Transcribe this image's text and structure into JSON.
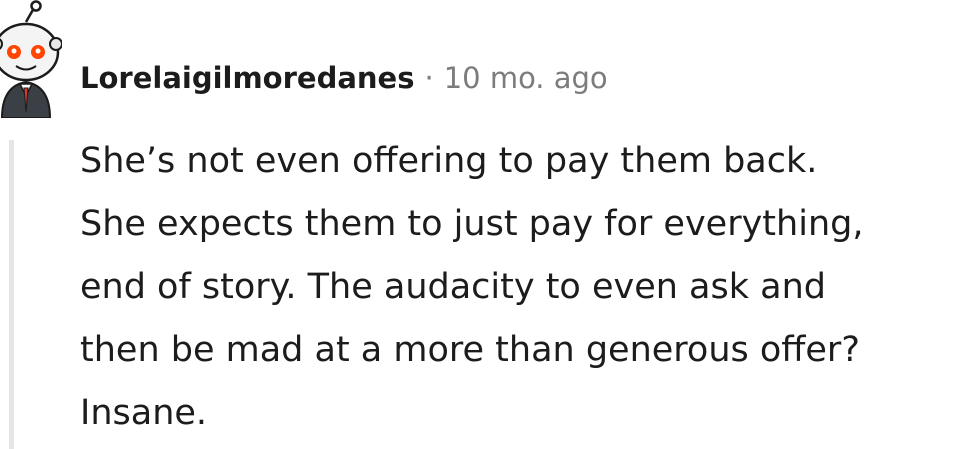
{
  "comment": {
    "username": "Lorelaigilmoredanes",
    "separator": "·",
    "timestamp": "10 mo. ago",
    "avatar_icon": "snoo-avatar-icon",
    "body": "She’s not even offering to pay them back.\nShe expects them to just pay for everything,\nend of story. The audacity to even ask and\nthen be mad at a more than generous offer?\nInsane."
  },
  "colors": {
    "text": "#1c1c1c",
    "meta": "#7c7c7c",
    "thread_line": "#e5e5e5",
    "avatar_accent": "#ff4500"
  }
}
